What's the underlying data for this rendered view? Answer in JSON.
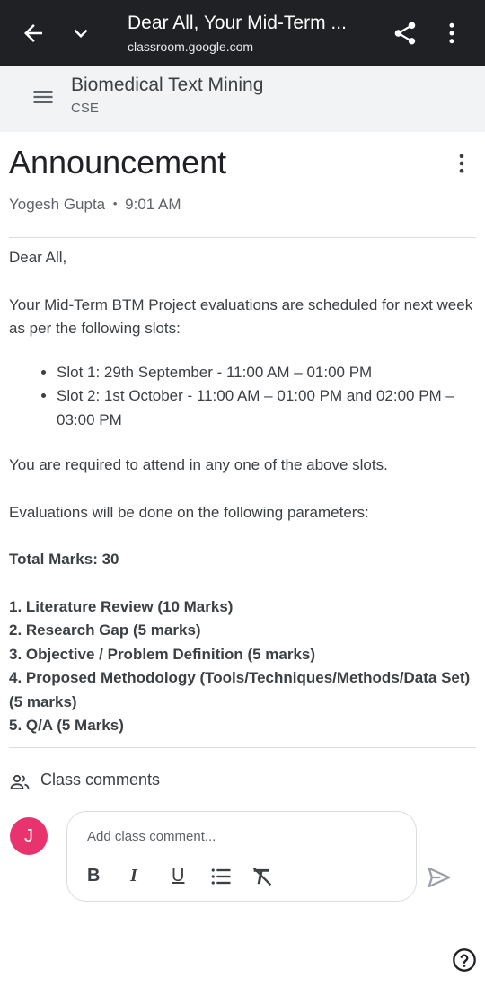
{
  "topbar": {
    "title": "Dear All, Your Mid-Term ...",
    "url": "classroom.google.com"
  },
  "course": {
    "name": "Biomedical Text Mining",
    "section": "CSE"
  },
  "announcement": {
    "heading": "Announcement",
    "author": "Yogesh Gupta",
    "separator": "•",
    "time": "9:01 AM",
    "greeting": "Dear All,",
    "intro": "Your Mid-Term BTM Project evaluations are scheduled for next week as per the following slots:",
    "slots": [
      "Slot 1: 29th September - 11:00 AM – 01:00 PM",
      "Slot 2: 1st October - 11:00 AM – 01:00 PM and 02:00 PM – 03:00 PM"
    ],
    "attend_note": "You are required to attend in any one of the above slots.",
    "params_intro": "Evaluations will be done on the following parameters:",
    "total_marks": "Total Marks: 30",
    "criteria": [
      "1. Literature Review (10 Marks)",
      "2. Research Gap (5 marks)",
      "3. Objective / Problem Definition (5 marks)",
      "4. Proposed Methodology (Tools/Techniques/Methods/Data Set) (5 marks)",
      "5. Q/A (5 Marks)"
    ]
  },
  "comments": {
    "label": "Class comments",
    "avatar_initial": "J",
    "placeholder": "Add class comment...",
    "format_bold": "B",
    "format_italic": "I",
    "format_underline": "U"
  },
  "colors": {
    "topbar": "#202124",
    "course_header": "#f1f3f4",
    "avatar": "#e8336e"
  },
  "icons": {
    "back": "arrow-back-icon",
    "expand": "chevron-down-icon",
    "share": "share-icon",
    "overflow": "more-vert-icon",
    "menu": "menu-icon",
    "people": "people-icon",
    "send": "send-icon",
    "list": "bulleted-list-icon",
    "clear_format": "clear-format-icon",
    "help": "help-icon"
  }
}
